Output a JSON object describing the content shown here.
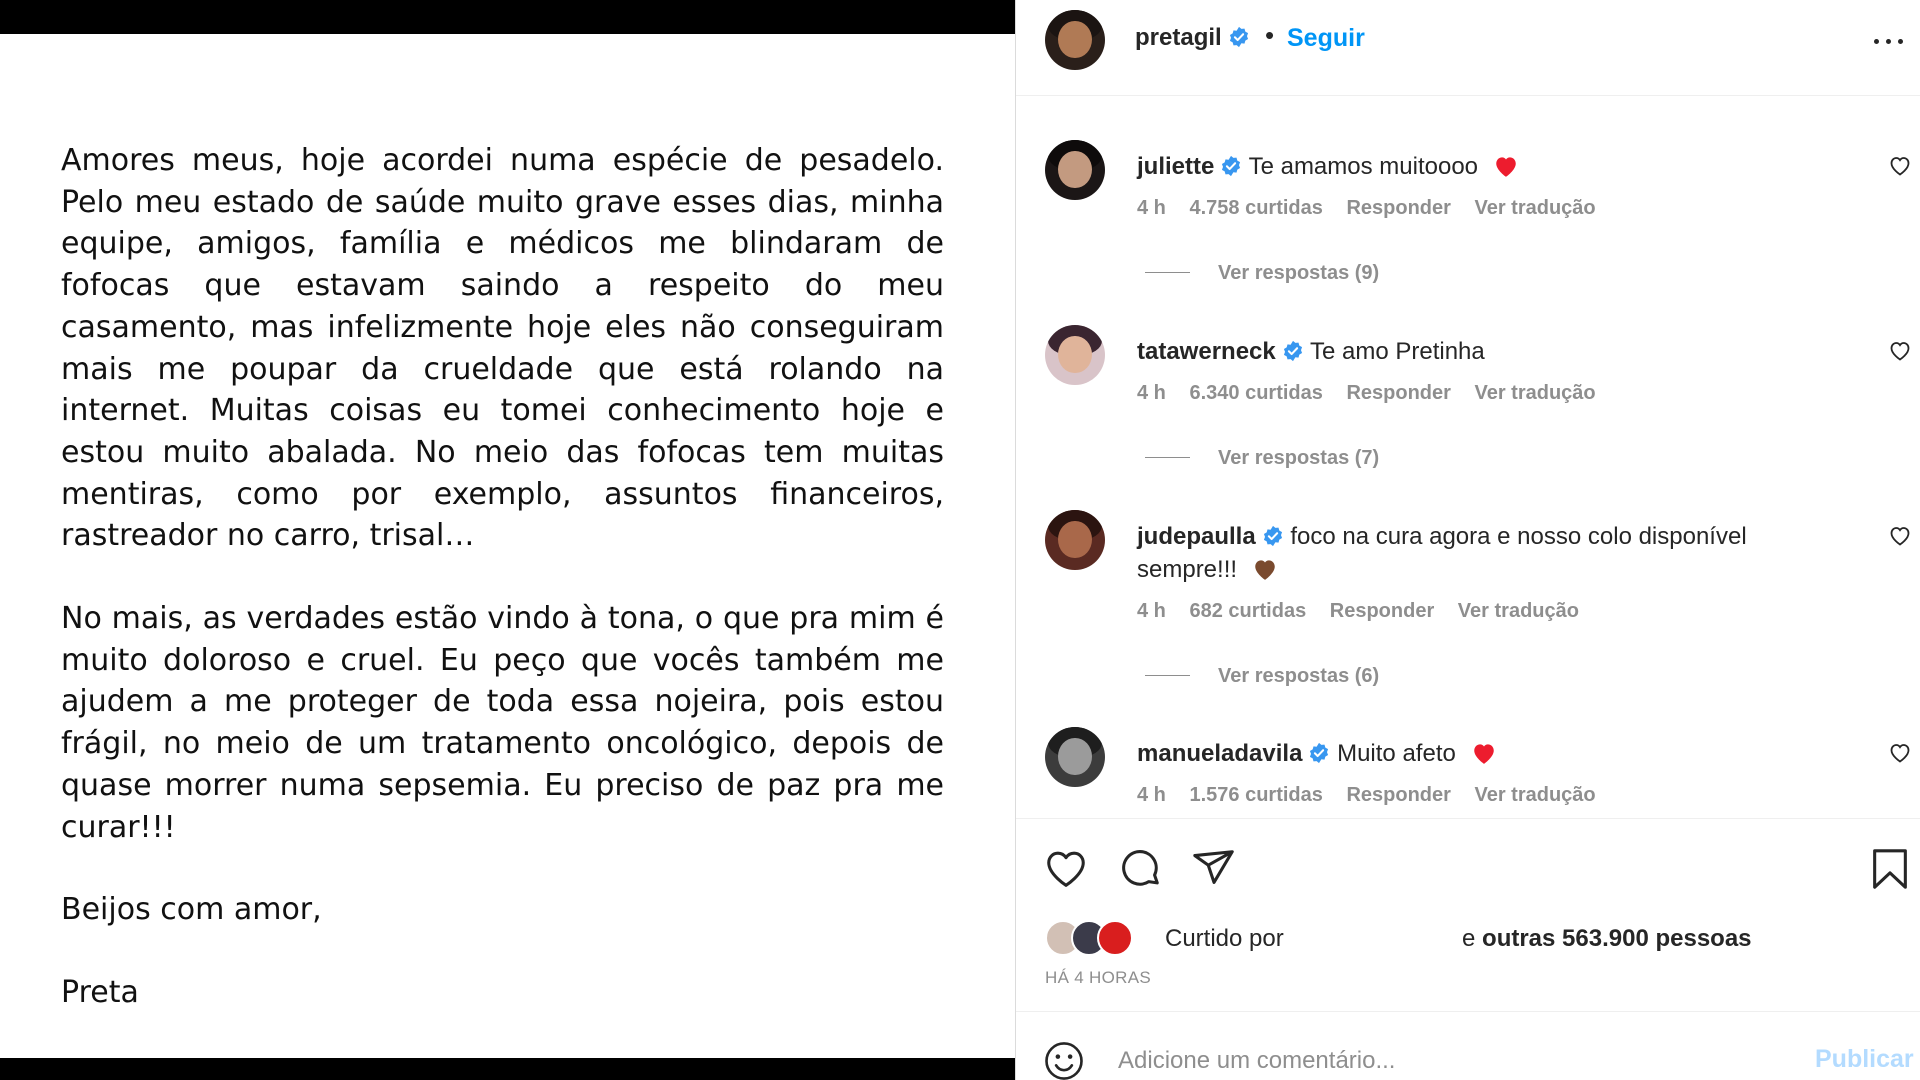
{
  "post": {
    "paragraphs": [
      "Amores meus, hoje acordei numa espécie de pesadelo. Pelo meu estado de saúde muito grave esses dias, minha equipe, amigos, família e médicos me blindaram de fofocas que estavam saindo a respeito do meu casamento, mas infelizmente hoje eles não conseguiram mais me poupar da crueldade que está rolando na internet. Muitas coisas eu tomei conhecimento hoje e estou muito abalada. No meio das fofocas tem muitas mentiras, como por exemplo, assuntos financeiros, rastreador no carro, trisal…",
      "No mais, as verdades estão vindo à tona, o que pra mim é muito doloroso e cruel. Eu peço que vocês também me ajudem a me proteger de toda essa nojeira, pois estou frágil, no meio de um tratamento oncológico, depois de quase morrer numa sepsemia. Eu preciso de paz pra me curar!!!",
      "Beijos com amor,",
      "Preta"
    ]
  },
  "header": {
    "username": "pretagil",
    "dot": "•",
    "follow_label": "Seguir"
  },
  "comments": [
    {
      "username": "juliette",
      "text": "Te amamos muitoooo",
      "emoji": "red-heart",
      "time": "4 h",
      "likes": "4.758 curtidas",
      "reply": "Responder",
      "translate": "Ver tradução",
      "replies": "Ver respostas (9)"
    },
    {
      "username": "tatawerneck",
      "text": "Te amo Pretinha",
      "emoji": "",
      "time": "4 h",
      "likes": "6.340 curtidas",
      "reply": "Responder",
      "translate": "Ver tradução",
      "replies": "Ver respostas (7)"
    },
    {
      "username": "judepaulla",
      "text": "foco na cura agora e nosso colo disponível sempre!!!",
      "emoji": "brown-heart",
      "time": "4 h",
      "likes": "682 curtidas",
      "reply": "Responder",
      "translate": "Ver tradução",
      "replies": "Ver respostas (6)"
    },
    {
      "username": "manueladavila",
      "text": "Muito afeto",
      "emoji": "red-heart",
      "time": "4 h",
      "likes": "1.576 curtidas",
      "reply": "Responder",
      "translate": "Ver tradução",
      "replies": ""
    }
  ],
  "likes": {
    "liked_by_label": "Curtido por",
    "others_prefix": "e",
    "others_bold": "outras 563.900 pessoas",
    "time_ago": "HÁ 4 HORAS"
  },
  "add_comment": {
    "placeholder": "Adicione um comentário...",
    "publish_label": "Publicar"
  },
  "colors": {
    "accent": "#0095f6",
    "publish_disabled": "#b3dbff",
    "verified": "#3897f0",
    "muted": "#8e8e8e",
    "red_heart": "#ed1c2e",
    "brown_heart": "#7a4a2e"
  }
}
